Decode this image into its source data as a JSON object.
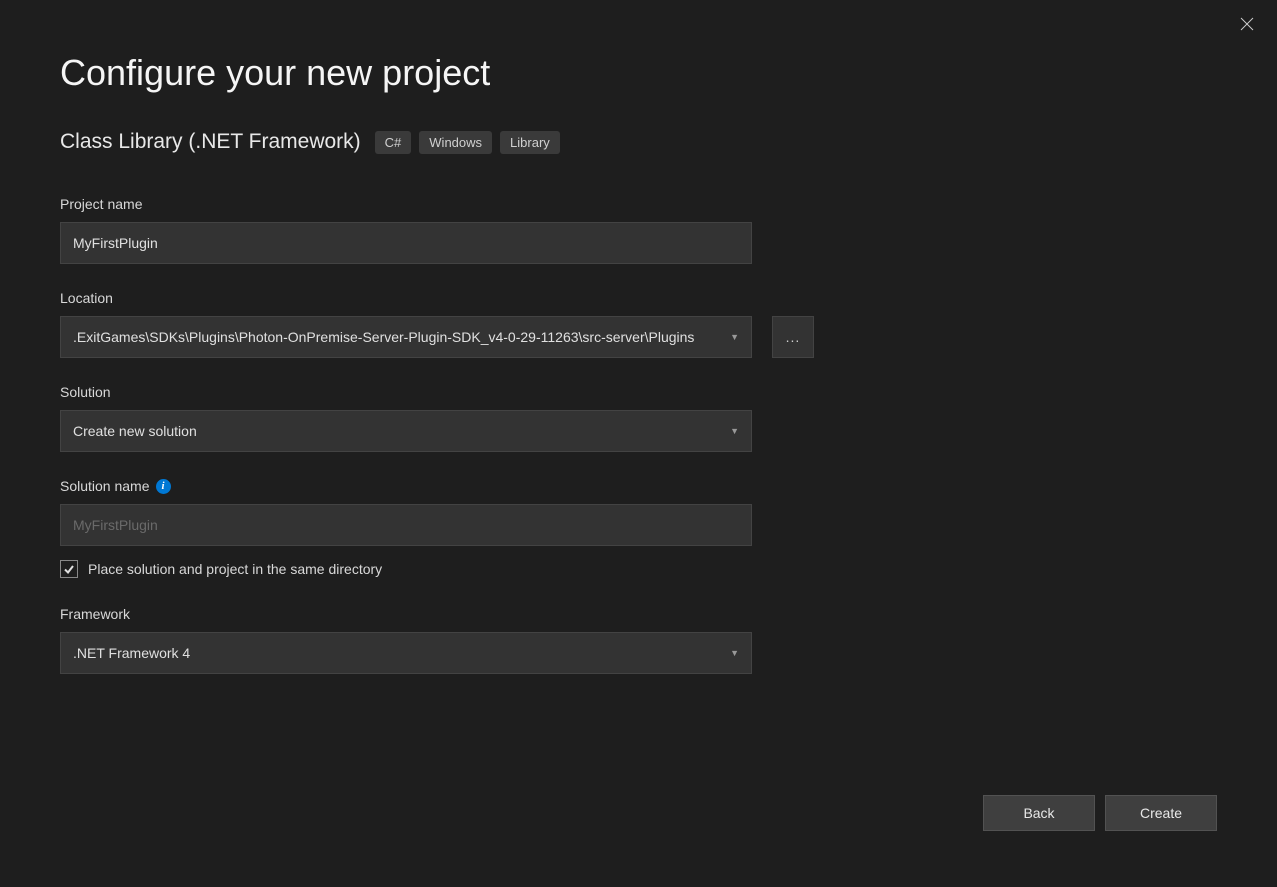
{
  "title": "Configure your new project",
  "template": {
    "name": "Class Library (.NET Framework)",
    "tags": [
      "C#",
      "Windows",
      "Library"
    ]
  },
  "fields": {
    "project_name": {
      "label": "Project name",
      "value": "MyFirstPlugin"
    },
    "location": {
      "label": "Location",
      "value": ".ExitGames\\SDKs\\Plugins\\Photon-OnPremise-Server-Plugin-SDK_v4-0-29-11263\\src-server\\Plugins",
      "browse_label": "..."
    },
    "solution": {
      "label": "Solution",
      "value": "Create new solution"
    },
    "solution_name": {
      "label": "Solution name",
      "placeholder": "MyFirstPlugin"
    },
    "same_dir": {
      "label": "Place solution and project in the same directory",
      "checked": true
    },
    "framework": {
      "label": "Framework",
      "value": ".NET Framework 4"
    }
  },
  "buttons": {
    "back": "Back",
    "create": "Create"
  }
}
